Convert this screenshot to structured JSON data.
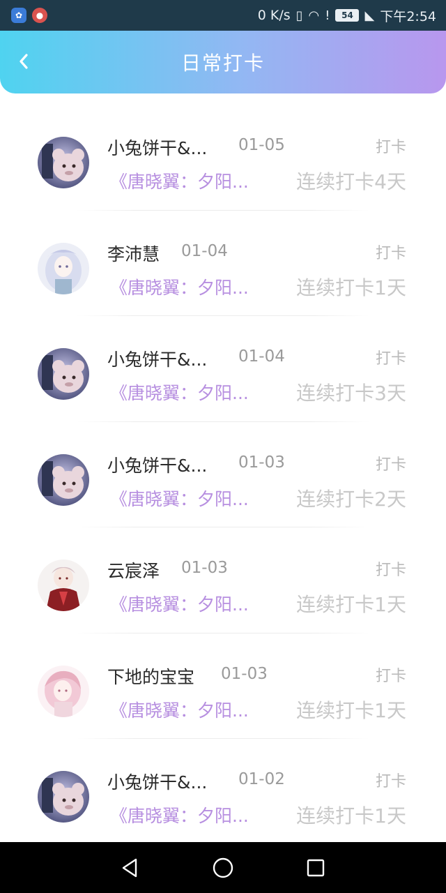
{
  "status_bar": {
    "speed": "0 K/s",
    "battery": "54",
    "time": "下午2:54"
  },
  "header": {
    "title": "日常打卡"
  },
  "items": [
    {
      "name": "小兔饼干&...",
      "date": "01-05",
      "action": "打卡",
      "book": "《唐晓翼：夕阳...",
      "streak": "连续打卡4天",
      "avatar": "bunny"
    },
    {
      "name": "李沛慧",
      "date": "01-04",
      "action": "打卡",
      "book": "《唐晓翼：夕阳...",
      "streak": "连续打卡1天",
      "avatar": "silver-hair"
    },
    {
      "name": "小兔饼干&...",
      "date": "01-04",
      "action": "打卡",
      "book": "《唐晓翼：夕阳...",
      "streak": "连续打卡3天",
      "avatar": "bunny"
    },
    {
      "name": "小兔饼干&...",
      "date": "01-03",
      "action": "打卡",
      "book": "《唐晓翼：夕阳...",
      "streak": "连续打卡2天",
      "avatar": "bunny"
    },
    {
      "name": "云宸泽",
      "date": "01-03",
      "action": "打卡",
      "book": "《唐晓翼：夕阳...",
      "streak": "连续打卡1天",
      "avatar": "red-coat"
    },
    {
      "name": "下地的宝宝",
      "date": "01-03",
      "action": "打卡",
      "book": "《唐晓翼：夕阳...",
      "streak": "连续打卡1天",
      "avatar": "pink-hair"
    },
    {
      "name": "小兔饼干&...",
      "date": "01-02",
      "action": "打卡",
      "book": "《唐晓翼：夕阳...",
      "streak": "连续打卡1天",
      "avatar": "bunny"
    }
  ],
  "colors": {
    "accent_purple": "#b78fe0",
    "header_gradient_start": "#4fd3f0",
    "header_gradient_end": "#b897ee"
  }
}
